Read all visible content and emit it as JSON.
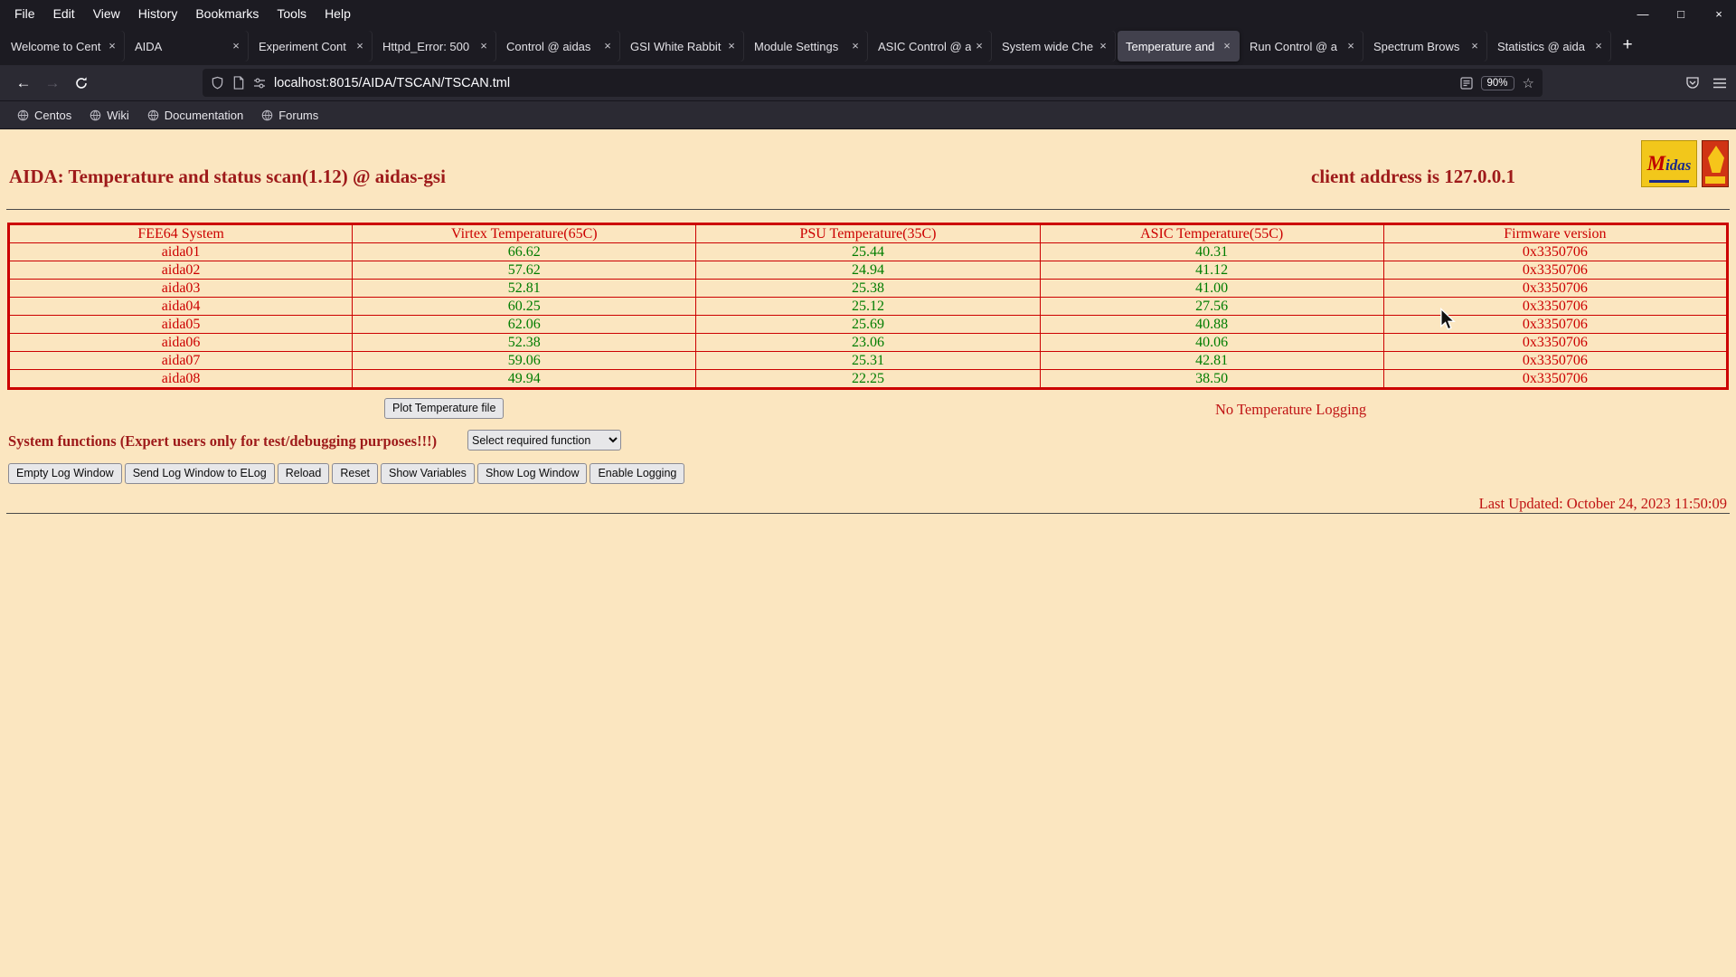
{
  "browser": {
    "menu": [
      "File",
      "Edit",
      "View",
      "History",
      "Bookmarks",
      "Tools",
      "Help"
    ],
    "icons": {
      "back": "←",
      "forward": "→",
      "star": "☆",
      "new_tab": "+",
      "close": "×",
      "minimize": "—",
      "maximize": "□"
    },
    "tabs": [
      {
        "label": "Welcome to Cent"
      },
      {
        "label": "AIDA"
      },
      {
        "label": "Experiment Cont"
      },
      {
        "label": "Httpd_Error: 500"
      },
      {
        "label": "Control @ aidas"
      },
      {
        "label": "GSI White Rabbit"
      },
      {
        "label": "Module Settings"
      },
      {
        "label": "ASIC Control @ a"
      },
      {
        "label": "System wide Che"
      },
      {
        "label": "Temperature and",
        "active": true
      },
      {
        "label": "Run Control @ a"
      },
      {
        "label": "Spectrum Brows"
      },
      {
        "label": "Statistics @ aida"
      }
    ],
    "url": "localhost:8015/AIDA/TSCAN/TSCAN.tml",
    "zoom": "90%",
    "bookmarks": [
      "Centos",
      "Wiki",
      "Documentation",
      "Forums"
    ]
  },
  "page": {
    "title": "AIDA: Temperature and status scan(1.12) @ aidas-gsi",
    "client_address": "client address is 127.0.0.1",
    "logo_text": "Midas",
    "table": {
      "headers": [
        "FEE64 System",
        "Virtex Temperature(65C)",
        "PSU Temperature(35C)",
        "ASIC Temperature(55C)",
        "Firmware version"
      ],
      "rows": [
        {
          "system": "aida01",
          "virtex": "66.62",
          "psu": "25.44",
          "asic": "40.31",
          "firmware": "0x3350706"
        },
        {
          "system": "aida02",
          "virtex": "57.62",
          "psu": "24.94",
          "asic": "41.12",
          "firmware": "0x3350706"
        },
        {
          "system": "aida03",
          "virtex": "52.81",
          "psu": "25.38",
          "asic": "41.00",
          "firmware": "0x3350706"
        },
        {
          "system": "aida04",
          "virtex": "60.25",
          "psu": "25.12",
          "asic": "27.56",
          "firmware": "0x3350706"
        },
        {
          "system": "aida05",
          "virtex": "62.06",
          "psu": "25.69",
          "asic": "40.88",
          "firmware": "0x3350706"
        },
        {
          "system": "aida06",
          "virtex": "52.38",
          "psu": "23.06",
          "asic": "40.06",
          "firmware": "0x3350706"
        },
        {
          "system": "aida07",
          "virtex": "59.06",
          "psu": "25.31",
          "asic": "42.81",
          "firmware": "0x3350706"
        },
        {
          "system": "aida08",
          "virtex": "49.94",
          "psu": "22.25",
          "asic": "38.50",
          "firmware": "0x3350706"
        }
      ]
    },
    "plot_button": "Plot Temperature file",
    "logging_status": "No Temperature Logging",
    "system_functions_label": "System functions (Expert users only for test/debugging purposes!!!)",
    "function_select": "Select required function",
    "action_buttons": [
      "Empty Log Window",
      "Send Log Window to ELog",
      "Reload",
      "Reset",
      "Show Variables",
      "Show Log Window",
      "Enable Logging"
    ],
    "last_updated": "Last Updated: October 24, 2023 11:50:09"
  },
  "colors": {
    "page_background": "#fbe6c0",
    "title_maroon": "#9e1a1a",
    "table_red": "#cc0000",
    "value_green": "#007d00"
  }
}
